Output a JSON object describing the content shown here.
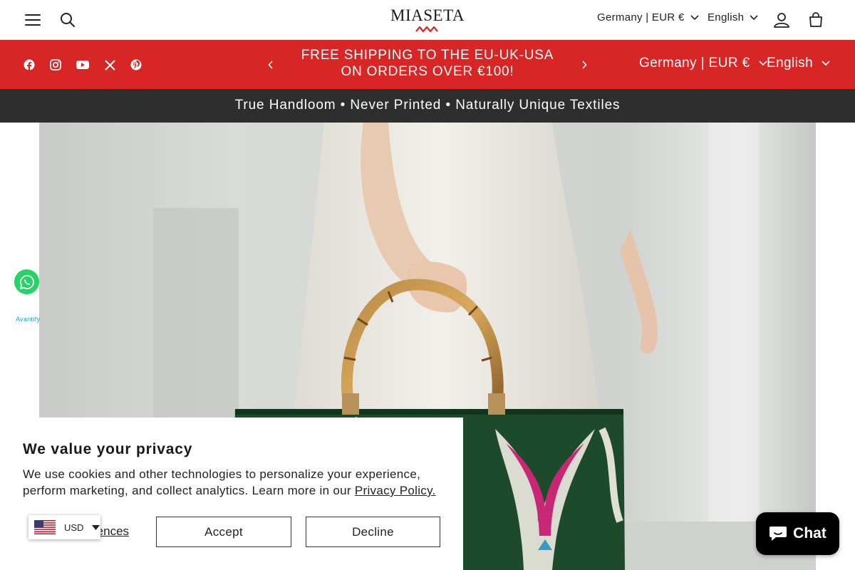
{
  "header": {
    "brand": "MIASETA",
    "country_selector": "Germany | EUR €",
    "language_selector": "English",
    "icons": [
      "menu-icon",
      "search-icon",
      "account-icon",
      "cart-icon"
    ]
  },
  "announcement": {
    "text": "FREE SHIPPING TO THE EU-UK-USA ON ORDERS OVER €100!",
    "country_selector": "Germany | EUR €",
    "language_selector": "English",
    "social_icons": [
      "facebook-icon",
      "instagram-icon",
      "youtube-icon",
      "x-icon",
      "pinterest-icon"
    ],
    "background": "#d82626"
  },
  "tagline": {
    "text": "True Handloom • Never Printed • Naturally Unique Textiles",
    "background": "#2e2e2e"
  },
  "whatsapp": {
    "caption": "Avantify",
    "color": "#25d366"
  },
  "cookie_banner": {
    "title": "We value your privacy",
    "body": "We use cookies and other technologies to personalize your experience, perform marketing, and collect analytics. Learn more in our ",
    "link_text": "Privacy Policy.",
    "preferences_label": "Preferences",
    "preferences_visible": "rences",
    "accept_label": "Accept",
    "decline_label": "Decline"
  },
  "currency_switcher": {
    "currency": "USD",
    "flag": "us-flag-icon"
  },
  "chat": {
    "label": "Chat"
  }
}
